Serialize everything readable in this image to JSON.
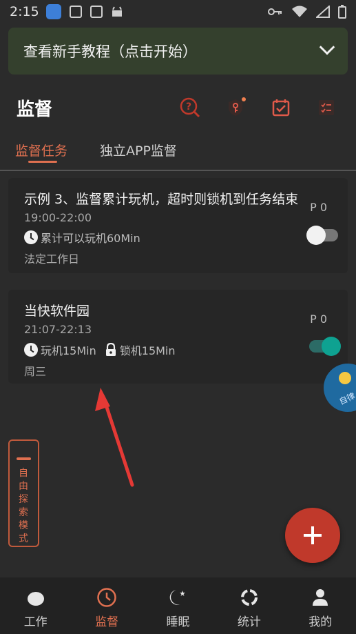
{
  "status_bar": {
    "time": "2:15"
  },
  "banner": {
    "text": "查看新手教程（点击开始）"
  },
  "header": {
    "title": "监督"
  },
  "tabs": [
    {
      "label": "监督任务",
      "active": true
    },
    {
      "label": "独立APP监督",
      "active": false
    }
  ],
  "tasks": [
    {
      "title": "示例 3、监督累计玩机，超时则锁机到任务结束",
      "time": "19:00-22:00",
      "play_limit": "累计可以玩机60Min",
      "days": "法定工作日",
      "priority": "P 0",
      "enabled": false
    },
    {
      "title": "当快软件园",
      "time": "21:07-22:13",
      "play_limit": "玩机15Min",
      "lock_limit": "锁机15Min",
      "days": "周三",
      "priority": "P 0",
      "enabled": true
    }
  ],
  "floating_badge": {
    "label": "自律"
  },
  "explore_mode": {
    "label": "自由探索模式"
  },
  "bottom_nav": [
    {
      "label": "工作",
      "icon": "tomato-icon",
      "active": false
    },
    {
      "label": "监督",
      "icon": "clock-icon",
      "active": true
    },
    {
      "label": "睡眠",
      "icon": "moon-icon",
      "active": false
    },
    {
      "label": "统计",
      "icon": "ring-chart-icon",
      "active": false
    },
    {
      "label": "我的",
      "icon": "person-icon",
      "active": false
    }
  ],
  "colors": {
    "accent": "#e07050",
    "toggle_on": "#0ea291",
    "fab": "#c0392b",
    "banner_bg": "#34402d"
  }
}
